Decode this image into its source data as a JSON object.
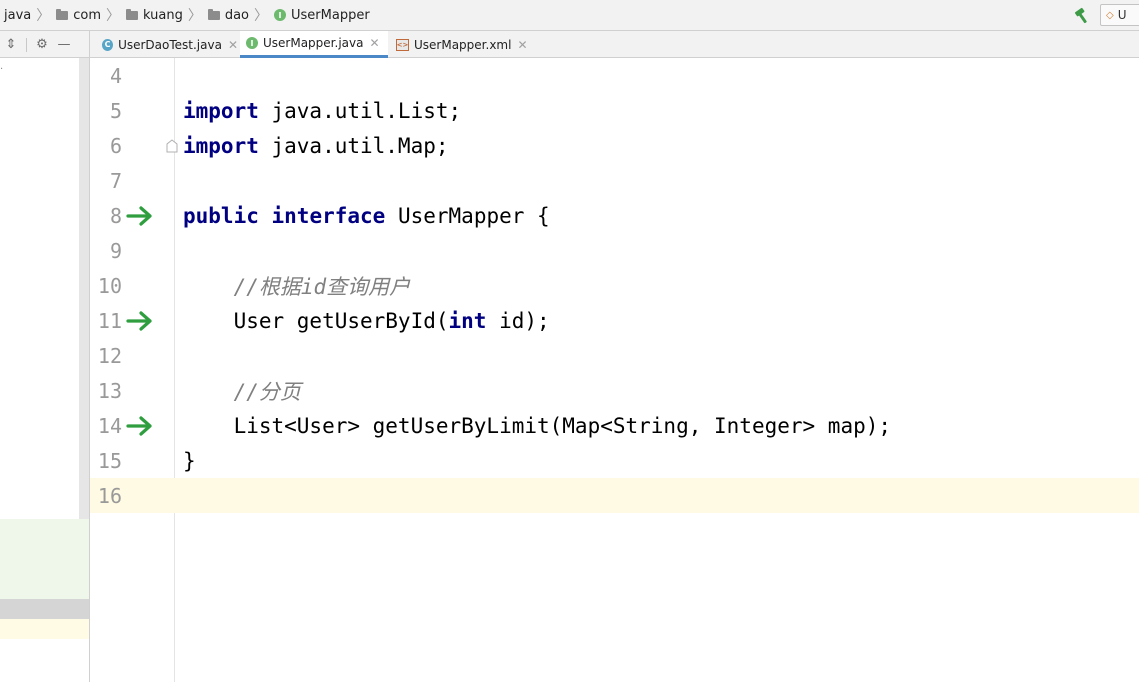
{
  "breadcrumb": {
    "items": [
      "java",
      "com",
      "kuang",
      "dao",
      "UserMapper"
    ],
    "item_icons": [
      "none",
      "folder-icon",
      "folder-icon",
      "folder-icon",
      "interface-icon"
    ]
  },
  "toolbar": {
    "build_icon": "hammer-icon",
    "run_config_label": "U"
  },
  "project_tools": {
    "icons": [
      "collapse-icon",
      "gear-icon",
      "minimize-icon"
    ]
  },
  "tabs": [
    {
      "label": "UserDaoTest.java",
      "icon": "class-icon",
      "active": false
    },
    {
      "label": "UserMapper.java",
      "icon": "interface-icon",
      "active": true
    },
    {
      "label": "UserMapper.xml",
      "icon": "xml-icon",
      "active": false
    }
  ],
  "editor": {
    "current_line": 16,
    "lines": [
      {
        "num": "4",
        "segments": []
      },
      {
        "num": "5",
        "segments": [
          {
            "t": "import",
            "k": "kw"
          },
          {
            "t": " java.util.List;",
            "k": ""
          }
        ]
      },
      {
        "num": "6",
        "segments": [
          {
            "t": "import",
            "k": "kw"
          },
          {
            "t": " java.util.Map;",
            "k": ""
          }
        ],
        "fold": true
      },
      {
        "num": "7",
        "segments": []
      },
      {
        "num": "8",
        "segments": [
          {
            "t": "public",
            "k": "kw"
          },
          {
            "t": " ",
            "k": ""
          },
          {
            "t": "interface",
            "k": "kw"
          },
          {
            "t": " UserMapper {",
            "k": ""
          }
        ],
        "marker": "implementation-arrow-icon"
      },
      {
        "num": "9",
        "segments": []
      },
      {
        "num": "10",
        "segments": [
          {
            "t": "    ",
            "k": ""
          },
          {
            "t": "//根据id查询用户",
            "k": "cm"
          }
        ]
      },
      {
        "num": "11",
        "segments": [
          {
            "t": "    User getUserById(",
            "k": ""
          },
          {
            "t": "int",
            "k": "kw"
          },
          {
            "t": " id);",
            "k": ""
          }
        ],
        "marker": "implementation-arrow-icon"
      },
      {
        "num": "12",
        "segments": []
      },
      {
        "num": "13",
        "segments": [
          {
            "t": "    ",
            "k": ""
          },
          {
            "t": "//分页",
            "k": "cm"
          }
        ]
      },
      {
        "num": "14",
        "segments": [
          {
            "t": "    List<User> getUserByLimit(Map<String, Integer> map);",
            "k": ""
          }
        ],
        "marker": "implementation-arrow-icon"
      },
      {
        "num": "15",
        "segments": [
          {
            "t": "}",
            "k": ""
          }
        ]
      },
      {
        "num": "16",
        "segments": []
      }
    ]
  },
  "colors": {
    "keyword": "#000080",
    "comment": "#808080",
    "line_number": "#999999",
    "current_line_bg": "#fffae3",
    "active_tab_underline": "#4a88c7",
    "gutter_arrow": "#2e9e3e"
  }
}
